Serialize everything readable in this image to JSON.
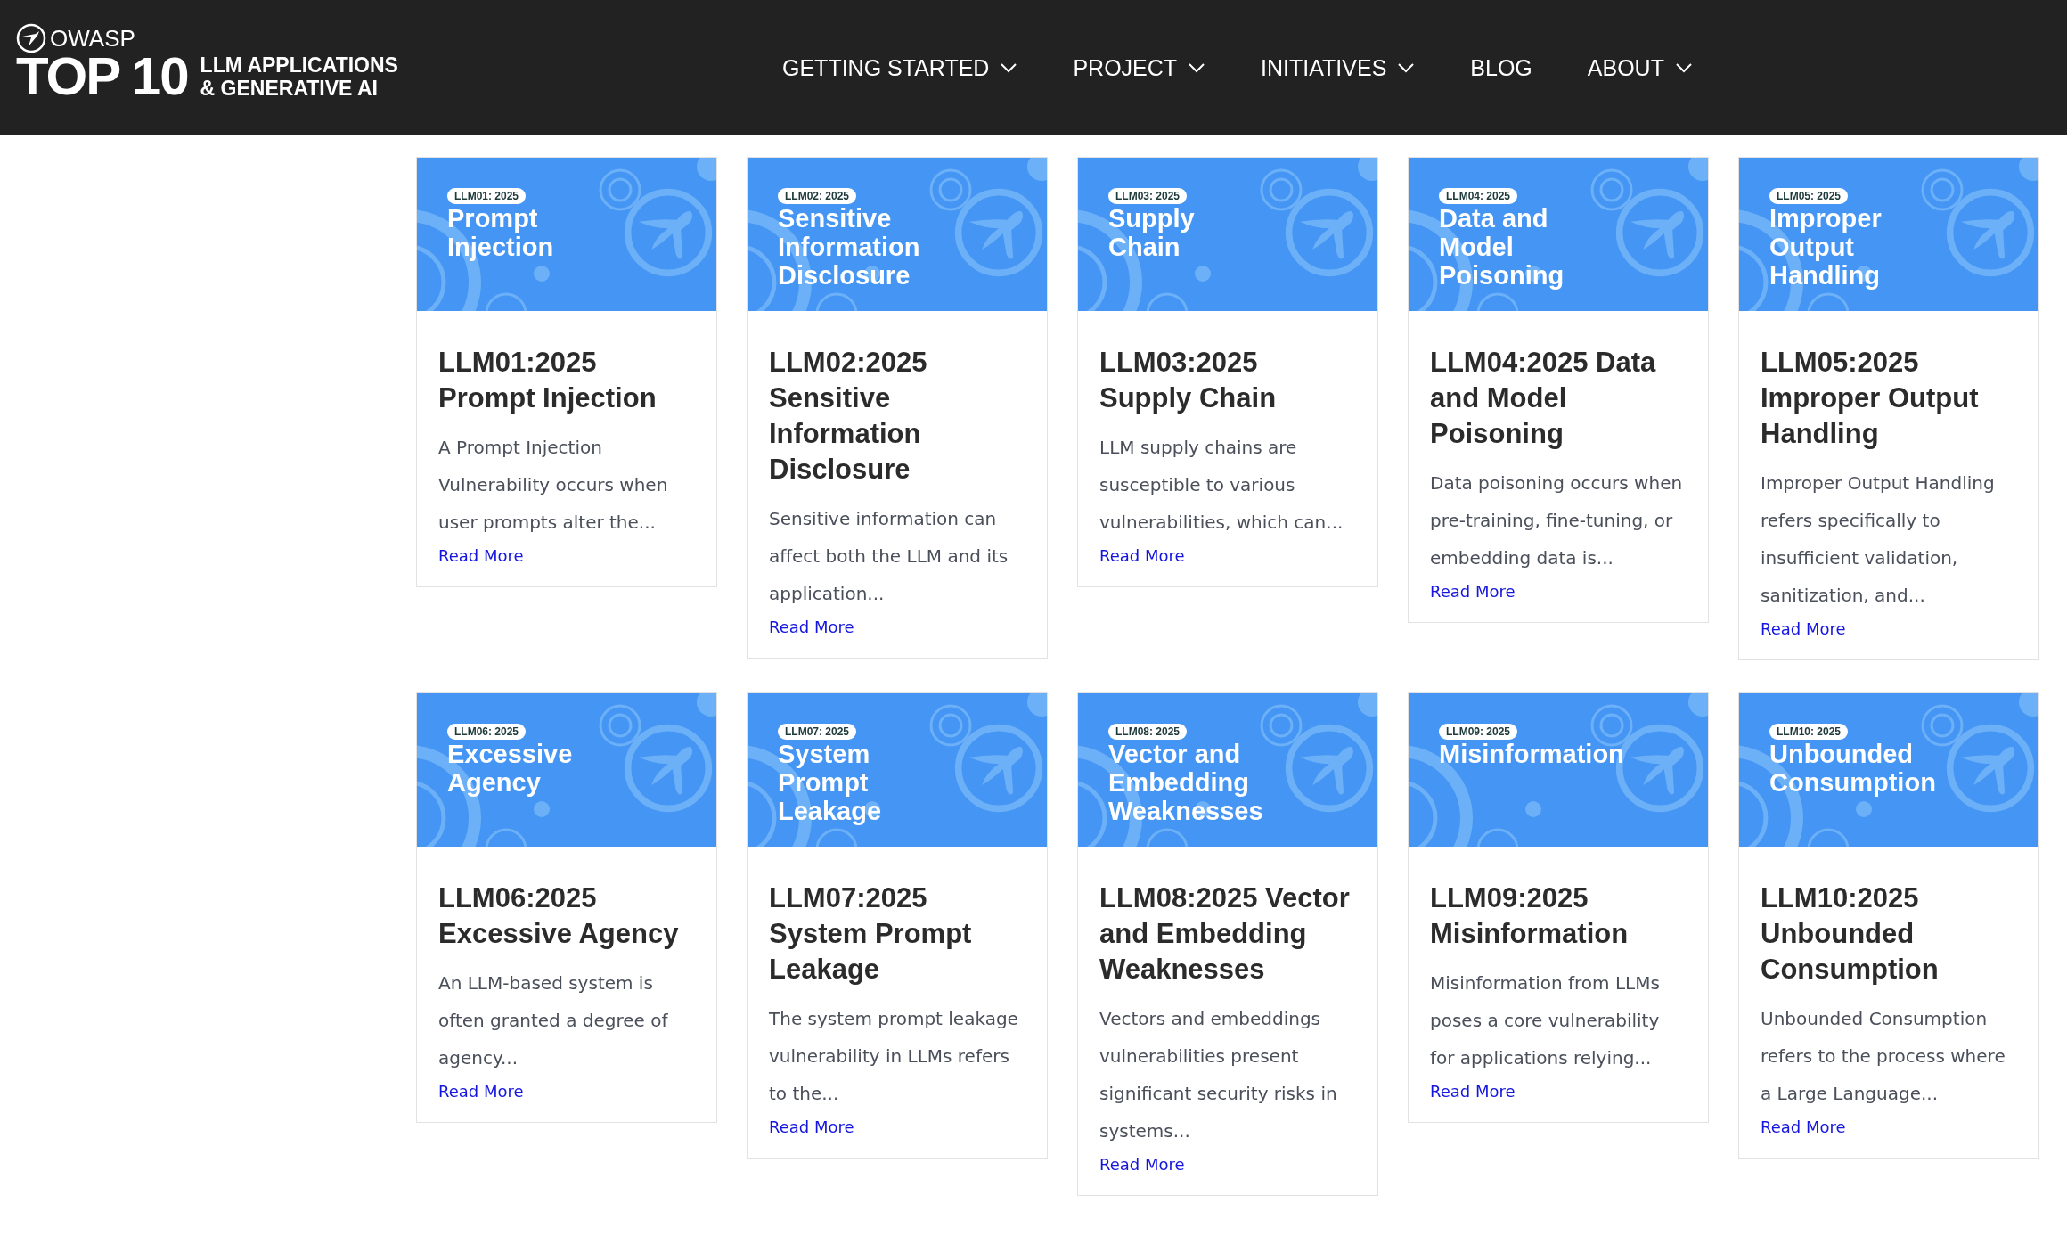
{
  "logo": {
    "brand": "OWASP",
    "top": "TOP 10",
    "subtitle_lines": [
      "LLM APPLICATIONS",
      "& GENERATIVE AI"
    ]
  },
  "nav": [
    {
      "label": "GETTING STARTED",
      "dropdown": true
    },
    {
      "label": "PROJECT",
      "dropdown": true
    },
    {
      "label": "INITIATIVES",
      "dropdown": true
    },
    {
      "label": "BLOG",
      "dropdown": false
    },
    {
      "label": "ABOUT",
      "dropdown": true
    }
  ],
  "cards": [
    {
      "badge": "LLM01: 2025",
      "banner_lines": [
        "Prompt",
        "Injection"
      ],
      "title": "LLM01:2025 Prompt Injection",
      "excerpt": "A Prompt Injection Vulnerability occurs when user prompts alter the...",
      "link": "Read More"
    },
    {
      "badge": "LLM02: 2025",
      "banner_lines": [
        "Sensitive",
        "Information",
        "Disclosure"
      ],
      "title": "LLM02:2025 Sensitive Information Disclosure",
      "excerpt": "Sensitive information can affect both the LLM and its application...",
      "link": "Read More"
    },
    {
      "badge": "LLM03: 2025",
      "banner_lines": [
        "Supply",
        "Chain"
      ],
      "title": "LLM03:2025 Supply Chain",
      "excerpt": "LLM supply chains are susceptible to various vulnerabilities, which can...",
      "link": "Read More"
    },
    {
      "badge": "LLM04: 2025",
      "banner_lines": [
        "Data and",
        "Model",
        "Poisoning"
      ],
      "title": "LLM04:2025 Data and Model Poisoning",
      "excerpt": "Data poisoning occurs when pre-training, fine-tuning, or embedding data is...",
      "link": "Read More"
    },
    {
      "badge": "LLM05: 2025",
      "banner_lines": [
        "Improper",
        "Output",
        "Handling"
      ],
      "title": "LLM05:2025 Improper Output Handling",
      "excerpt": "Improper Output Handling refers specifically to insufficient validation, sanitization, and...",
      "link": "Read More"
    },
    {
      "badge": "LLM06: 2025",
      "banner_lines": [
        "Excessive",
        "Agency"
      ],
      "title": "LLM06:2025 Excessive Agency",
      "excerpt": "An LLM-based system is often granted a degree of agency...",
      "link": "Read More"
    },
    {
      "badge": "LLM07: 2025",
      "banner_lines": [
        "System",
        "Prompt",
        "Leakage"
      ],
      "title": "LLM07:2025 System Prompt Leakage",
      "excerpt": "The system prompt leakage vulnerability in LLMs refers to the...",
      "link": "Read More"
    },
    {
      "badge": "LLM08: 2025",
      "banner_lines": [
        "Vector and",
        "Embedding",
        "Weaknesses"
      ],
      "title": "LLM08:2025 Vector and Embedding Weaknesses",
      "excerpt": "Vectors and embeddings vulnerabilities present significant security risks in systems...",
      "link": "Read More"
    },
    {
      "badge": "LLM09: 2025",
      "banner_lines": [
        "Misinformation"
      ],
      "title": "LLM09:2025 Misinformation",
      "excerpt": "Misinformation from LLMs poses a core vulnerability for applications relying...",
      "link": "Read More"
    },
    {
      "badge": "LLM10: 2025",
      "banner_lines": [
        "Unbounded",
        "Consumption"
      ],
      "title": "LLM10:2025 Unbounded Consumption",
      "excerpt": "Unbounded Consumption refers to the process where a Large Language...",
      "link": "Read More"
    }
  ]
}
